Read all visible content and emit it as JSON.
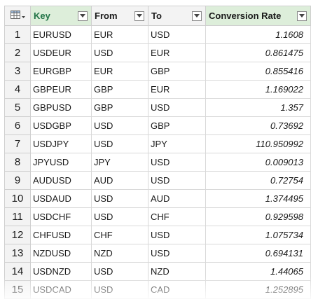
{
  "columns": [
    {
      "label": "Key"
    },
    {
      "label": "From"
    },
    {
      "label": "To"
    },
    {
      "label": "Conversion Rate"
    }
  ],
  "rows": [
    {
      "n": "1",
      "key": "EURUSD",
      "from": "EUR",
      "to": "USD",
      "rate": "1.1608"
    },
    {
      "n": "2",
      "key": "USDEUR",
      "from": "USD",
      "to": "EUR",
      "rate": "0.861475"
    },
    {
      "n": "3",
      "key": "EURGBP",
      "from": "EUR",
      "to": "GBP",
      "rate": "0.855416"
    },
    {
      "n": "4",
      "key": "GBPEUR",
      "from": "GBP",
      "to": "EUR",
      "rate": "1.169022"
    },
    {
      "n": "5",
      "key": "GBPUSD",
      "from": "GBP",
      "to": "USD",
      "rate": "1.357"
    },
    {
      "n": "6",
      "key": "USDGBP",
      "from": "USD",
      "to": "GBP",
      "rate": "0.73692"
    },
    {
      "n": "7",
      "key": "USDJPY",
      "from": "USD",
      "to": "JPY",
      "rate": "110.950992"
    },
    {
      "n": "8",
      "key": "JPYUSD",
      "from": "JPY",
      "to": "USD",
      "rate": "0.009013"
    },
    {
      "n": "9",
      "key": "AUDUSD",
      "from": "AUD",
      "to": "USD",
      "rate": "0.72754"
    },
    {
      "n": "10",
      "key": "USDAUD",
      "from": "USD",
      "to": "AUD",
      "rate": "1.374495"
    },
    {
      "n": "11",
      "key": "USDCHF",
      "from": "USD",
      "to": "CHF",
      "rate": "0.929598"
    },
    {
      "n": "12",
      "key": "CHFUSD",
      "from": "CHF",
      "to": "USD",
      "rate": "1.075734"
    },
    {
      "n": "13",
      "key": "NZDUSD",
      "from": "NZD",
      "to": "USD",
      "rate": "0.694131"
    },
    {
      "n": "14",
      "key": "USDNZD",
      "from": "USD",
      "to": "NZD",
      "rate": "1.44065"
    },
    {
      "n": "15",
      "key": "USDCAD",
      "from": "USD",
      "to": "CAD",
      "rate": "1.252895"
    }
  ],
  "icons": {
    "corner": "table-icon",
    "filter": "filter-dropdown-icon"
  },
  "colors": {
    "selected_header_bg": "#ddeeda",
    "selected_header_text": "#217346",
    "header_bg": "#f3f3f3",
    "grid_line": "#d9d9d9"
  }
}
